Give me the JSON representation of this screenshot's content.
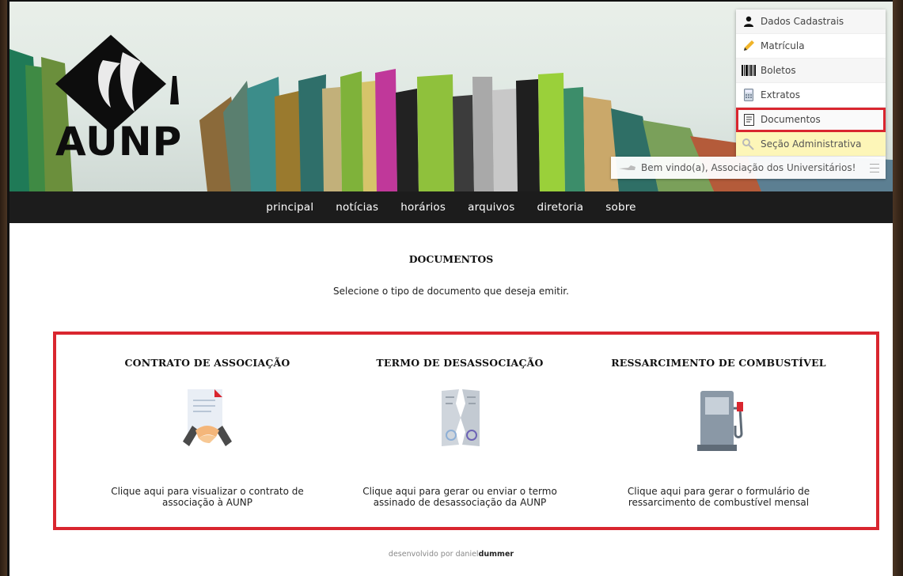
{
  "brand": {
    "logo_text": "AUNP"
  },
  "nav": {
    "items": [
      "principal",
      "notícias",
      "horários",
      "arquivos",
      "diretoria",
      "sobre"
    ]
  },
  "user_menu": {
    "items": [
      {
        "label": "Dados Cadastrais",
        "icon": "user-icon"
      },
      {
        "label": "Matrícula",
        "icon": "pencil-icon"
      },
      {
        "label": "Boletos",
        "icon": "barcode-icon"
      },
      {
        "label": "Extratos",
        "icon": "calculator-icon"
      },
      {
        "label": "Documentos",
        "icon": "document-icon",
        "active": true
      },
      {
        "label": "Seção Administrativa",
        "icon": "key-icon"
      }
    ],
    "welcome": "Bem vindo(a), Associação dos Universitários!"
  },
  "main": {
    "title": "DOCUMENTOS",
    "subtitle": "Selecione o tipo de documento que deseja emitir.",
    "documents": [
      {
        "title": "CONTRATO DE ASSOCIAÇÃO",
        "desc_line1": "Clique aqui para visualizar o contrato de",
        "desc_line2": "associação à AUNP",
        "icon": "contract-handshake-icon"
      },
      {
        "title": "TERMO DE DESASSOCIAÇÃO",
        "desc_line1": "Clique aqui para gerar ou enviar o termo",
        "desc_line2": "assinado de desassociação da AUNP",
        "icon": "torn-document-icon"
      },
      {
        "title": "RESSARCIMENTO DE COMBUSTÍVEL",
        "desc_line1": "Clique aqui para gerar o formulário de",
        "desc_line2": "ressarcimento de combustível mensal",
        "icon": "fuel-pump-icon"
      }
    ]
  },
  "footer": {
    "prefix": "desenvolvido por daniel",
    "bold": "dummer"
  },
  "colors": {
    "highlight": "#d9262f",
    "navbar": "#1c1c1c",
    "admin_bg": "#fdf6b8"
  }
}
